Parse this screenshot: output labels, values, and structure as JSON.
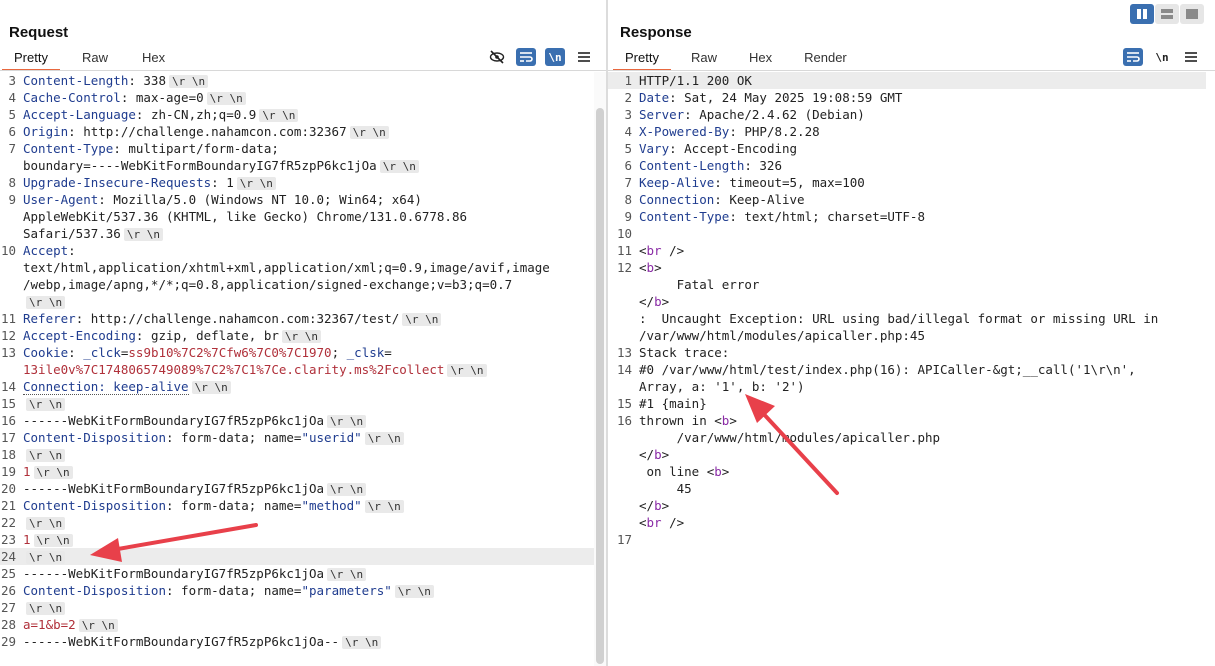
{
  "layout_toggle": {
    "buttons": [
      {
        "icon": "columns-layout-icon",
        "active": true
      },
      {
        "icon": "rows-layout-icon",
        "active": false
      },
      {
        "icon": "single-pane-layout-icon",
        "active": false
      }
    ]
  },
  "request": {
    "title": "Request",
    "tabs": [
      "Pretty",
      "Raw",
      "Hex"
    ],
    "active_tab": "Pretty",
    "tools": [
      {
        "name": "hide-nonprinting-icon",
        "style": "plain"
      },
      {
        "name": "wrap-lines-icon",
        "style": "blue"
      },
      {
        "name": "show-newlines-icon",
        "style": "blue",
        "text": "\\n"
      },
      {
        "name": "menu-icon",
        "style": "plain"
      }
    ],
    "lines": [
      {
        "n": "3",
        "parts": [
          {
            "t": "Content-Length",
            "c": "hname"
          },
          {
            "t": ": 338"
          }
        ],
        "nl": true
      },
      {
        "n": "4",
        "parts": [
          {
            "t": "Cache-Control",
            "c": "hname"
          },
          {
            "t": ": max-age=0"
          }
        ],
        "nl": true
      },
      {
        "n": "5",
        "parts": [
          {
            "t": "Accept-Language",
            "c": "hname"
          },
          {
            "t": ": zh-CN,zh;q=0.9"
          }
        ],
        "nl": true
      },
      {
        "n": "6",
        "parts": [
          {
            "t": "Origin",
            "c": "hname"
          },
          {
            "t": ": http://challenge.nahamcon.com:32367"
          }
        ],
        "nl": true
      },
      {
        "n": "7",
        "parts": [
          {
            "t": "Content-Type",
            "c": "hname"
          },
          {
            "t": ": multipart/form-data;"
          }
        ]
      },
      {
        "n": "",
        "parts": [
          {
            "t": "boundary=----WebKitFormBoundaryIG7fR5zpP6kc1jOa"
          }
        ],
        "nl": true
      },
      {
        "n": "8",
        "parts": [
          {
            "t": "Upgrade-Insecure-Requests",
            "c": "hname"
          },
          {
            "t": ": 1"
          }
        ],
        "nl": true
      },
      {
        "n": "9",
        "parts": [
          {
            "t": "User-Agent",
            "c": "hname"
          },
          {
            "t": ": Mozilla/5.0 (Windows NT 10.0; Win64; x64)"
          }
        ]
      },
      {
        "n": "",
        "parts": [
          {
            "t": "AppleWebKit/537.36 (KHTML, like Gecko) Chrome/131.0.6778.86"
          }
        ]
      },
      {
        "n": "",
        "parts": [
          {
            "t": "Safari/537.36"
          }
        ],
        "nl": true
      },
      {
        "n": "10",
        "parts": [
          {
            "t": "Accept",
            "c": "hname"
          },
          {
            "t": ":"
          }
        ]
      },
      {
        "n": "",
        "parts": [
          {
            "t": "text/html,application/xhtml+xml,application/xml;q=0.9,image/avif,image"
          }
        ]
      },
      {
        "n": "",
        "parts": [
          {
            "t": "/webp,image/apng,*/*;q=0.8,application/signed-exchange;v=b3;q=0.7"
          }
        ]
      },
      {
        "n": "",
        "parts": [],
        "nl": true
      },
      {
        "n": "11",
        "parts": [
          {
            "t": "Referer",
            "c": "hname"
          },
          {
            "t": ": http://challenge.nahamcon.com:32367/test/"
          }
        ],
        "nl": true
      },
      {
        "n": "12",
        "parts": [
          {
            "t": "Accept-Encoding",
            "c": "hname"
          },
          {
            "t": ": gzip, deflate, br"
          }
        ],
        "nl": true
      },
      {
        "n": "13",
        "parts": [
          {
            "t": "Cookie",
            "c": "hname"
          },
          {
            "t": ": "
          },
          {
            "t": "_clck",
            "c": "hname"
          },
          {
            "t": "="
          },
          {
            "t": "ss9b10%7C2%7Cfw6%7C0%7C1970",
            "c": "red"
          },
          {
            "t": "; "
          },
          {
            "t": "_clsk",
            "c": "hname"
          },
          {
            "t": "="
          }
        ]
      },
      {
        "n": "",
        "parts": [
          {
            "t": "13ile0v%7C1748065749089%7C2%7C1%7Ce.clarity.ms%2Fcollect",
            "c": "red"
          }
        ],
        "nl": true
      },
      {
        "n": "14",
        "parts": [
          {
            "t": "Connection: keep-alive",
            "c": "hname dotted"
          }
        ],
        "nl": true
      },
      {
        "n": "15",
        "parts": [],
        "nl": true
      },
      {
        "n": "16",
        "parts": [
          {
            "t": "------WebKitFormBoundaryIG7fR5zpP6kc1jOa"
          }
        ],
        "nl": true
      },
      {
        "n": "17",
        "parts": [
          {
            "t": "Content-Disposition",
            "c": "hname"
          },
          {
            "t": ": form-data; name="
          },
          {
            "t": "\"userid\"",
            "c": "hname"
          }
        ],
        "nl": true
      },
      {
        "n": "18",
        "parts": [],
        "nl": true
      },
      {
        "n": "19",
        "parts": [
          {
            "t": "1",
            "c": "red"
          }
        ],
        "nl": true
      },
      {
        "n": "20",
        "parts": [
          {
            "t": "------WebKitFormBoundaryIG7fR5zpP6kc1jOa"
          }
        ],
        "nl": true
      },
      {
        "n": "21",
        "parts": [
          {
            "t": "Content-Disposition",
            "c": "hname"
          },
          {
            "t": ": form-data; name="
          },
          {
            "t": "\"method\"",
            "c": "hname"
          }
        ],
        "nl": true
      },
      {
        "n": "22",
        "parts": [],
        "nl": true
      },
      {
        "n": "23",
        "parts": [
          {
            "t": "1",
            "c": "red"
          }
        ],
        "nl": true
      },
      {
        "n": "24",
        "parts": [],
        "nl": true,
        "highlight": true
      },
      {
        "n": "25",
        "parts": [
          {
            "t": "------WebKitFormBoundaryIG7fR5zpP6kc1jOa"
          }
        ],
        "nl": true
      },
      {
        "n": "26",
        "parts": [
          {
            "t": "Content-Disposition",
            "c": "hname"
          },
          {
            "t": ": form-data; name="
          },
          {
            "t": "\"parameters\"",
            "c": "hname"
          }
        ],
        "nl": true
      },
      {
        "n": "27",
        "parts": [],
        "nl": true
      },
      {
        "n": "28",
        "parts": [
          {
            "t": "a=1&b=2",
            "c": "red"
          }
        ],
        "nl": true
      },
      {
        "n": "29",
        "parts": [
          {
            "t": "------WebKitFormBoundaryIG7fR5zpP6kc1jOa--"
          }
        ],
        "nl": true
      }
    ]
  },
  "response": {
    "title": "Response",
    "tabs": [
      "Pretty",
      "Raw",
      "Hex",
      "Render"
    ],
    "active_tab": "Pretty",
    "tools": [
      {
        "name": "wrap-lines-icon",
        "style": "blue"
      },
      {
        "name": "show-newlines-icon",
        "style": "plain",
        "text": "\\n"
      },
      {
        "name": "menu-icon",
        "style": "plain"
      }
    ],
    "lines": [
      {
        "n": "1",
        "parts": [
          {
            "t": "HTTP/1.1 200 OK"
          }
        ],
        "highlight": true
      },
      {
        "n": "2",
        "parts": [
          {
            "t": "Date",
            "c": "hname"
          },
          {
            "t": ": Sat, 24 May 2025 19:08:59 GMT"
          }
        ]
      },
      {
        "n": "3",
        "parts": [
          {
            "t": "Server",
            "c": "hname"
          },
          {
            "t": ": Apache/2.4.62 (Debian)"
          }
        ]
      },
      {
        "n": "4",
        "parts": [
          {
            "t": "X-Powered-By",
            "c": "hname"
          },
          {
            "t": ": PHP/8.2.28"
          }
        ]
      },
      {
        "n": "5",
        "parts": [
          {
            "t": "Vary",
            "c": "hname"
          },
          {
            "t": ": Accept-Encoding"
          }
        ]
      },
      {
        "n": "6",
        "parts": [
          {
            "t": "Content-Length",
            "c": "hname"
          },
          {
            "t": ": 326"
          }
        ]
      },
      {
        "n": "7",
        "parts": [
          {
            "t": "Keep-Alive",
            "c": "hname"
          },
          {
            "t": ": timeout=5, max=100"
          }
        ]
      },
      {
        "n": "8",
        "parts": [
          {
            "t": "Connection",
            "c": "hname"
          },
          {
            "t": ": Keep-Alive"
          }
        ]
      },
      {
        "n": "9",
        "parts": [
          {
            "t": "Content-Type",
            "c": "hname"
          },
          {
            "t": ": text/html; charset=UTF-8"
          }
        ]
      },
      {
        "n": "10",
        "parts": []
      },
      {
        "n": "11",
        "parts": [
          {
            "t": "<"
          },
          {
            "t": "br",
            "c": "tag"
          },
          {
            "t": " />"
          }
        ]
      },
      {
        "n": "12",
        "parts": [
          {
            "t": "<"
          },
          {
            "t": "b",
            "c": "tag"
          },
          {
            "t": ">"
          }
        ]
      },
      {
        "n": "",
        "parts": [
          {
            "t": "     Fatal error"
          }
        ]
      },
      {
        "n": "",
        "parts": [
          {
            "t": "</"
          },
          {
            "t": "b",
            "c": "tag"
          },
          {
            "t": ">"
          }
        ]
      },
      {
        "n": "",
        "parts": [
          {
            "t": ":  Uncaught Exception: URL using bad/illegal format or missing URL in"
          }
        ]
      },
      {
        "n": "",
        "parts": [
          {
            "t": "/var/www/html/modules/apicaller.php:45"
          }
        ]
      },
      {
        "n": "13",
        "parts": [
          {
            "t": "Stack trace:"
          }
        ]
      },
      {
        "n": "14",
        "parts": [
          {
            "t": "#0 /var/www/html/test/index.php(16): APICaller-&gt;__call('1\\r\\n',"
          }
        ]
      },
      {
        "n": "",
        "parts": [
          {
            "t": "Array, a: '1', b: '2')"
          }
        ]
      },
      {
        "n": "15",
        "parts": [
          {
            "t": "#1 {main}"
          }
        ]
      },
      {
        "n": "16",
        "parts": [
          {
            "t": "thrown in <"
          },
          {
            "t": "b",
            "c": "tag"
          },
          {
            "t": ">"
          }
        ]
      },
      {
        "n": "",
        "parts": [
          {
            "t": "     /var/www/html/modules/apicaller.php"
          }
        ]
      },
      {
        "n": "",
        "parts": [
          {
            "t": "</"
          },
          {
            "t": "b",
            "c": "tag"
          },
          {
            "t": ">"
          }
        ]
      },
      {
        "n": "",
        "parts": [
          {
            "t": " on line <"
          },
          {
            "t": "b",
            "c": "tag"
          },
          {
            "t": ">"
          }
        ]
      },
      {
        "n": "",
        "parts": [
          {
            "t": "     45"
          }
        ]
      },
      {
        "n": "",
        "parts": [
          {
            "t": "</"
          },
          {
            "t": "b",
            "c": "tag"
          },
          {
            "t": ">"
          }
        ]
      },
      {
        "n": "",
        "parts": [
          {
            "t": "<"
          },
          {
            "t": "br",
            "c": "tag"
          },
          {
            "t": " />"
          }
        ]
      },
      {
        "n": "17",
        "parts": []
      }
    ]
  },
  "newline_marker": "\\r \\n",
  "colors": {
    "accent": "#3a6fb0",
    "tab_underline": "#e8683f",
    "annotation_arrow": "#e8404a",
    "header_name": "#1f3c8f",
    "value_red": "#b0303a",
    "tag_purple": "#8a2ba6"
  },
  "annotations": [
    {
      "name": "annotation-arrow-request-line-24",
      "points_to": "request line 24"
    },
    {
      "name": "annotation-arrow-response-line-14",
      "points_to": "response line 14"
    }
  ]
}
